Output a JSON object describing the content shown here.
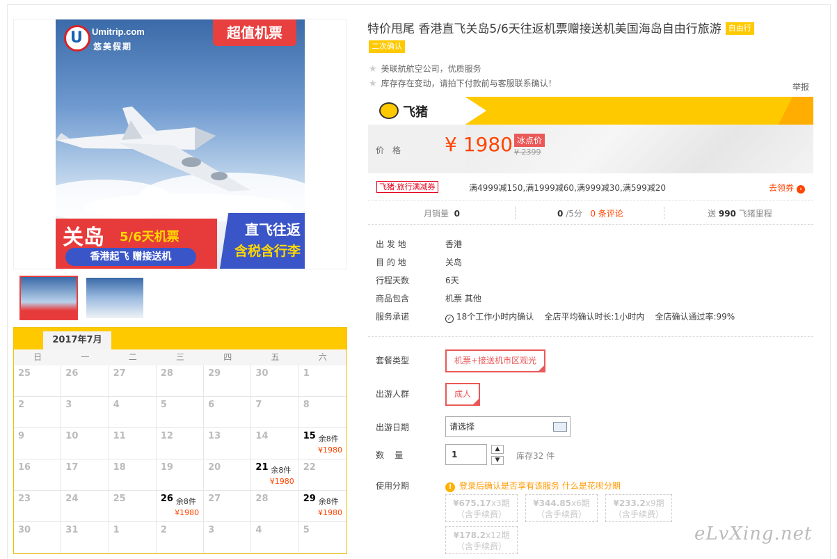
{
  "product": {
    "title": "特价甩尾 香港直飞关岛5/6天往返机票赠接送机美国海岛自由行旅游",
    "tag_free": "自由行",
    "tag_confirm": "二次确认",
    "notes": [
      "美联航航空公司，优质服务",
      "库存存在变动，请拍下付款前与客服联系确认！"
    ],
    "report": "举报"
  },
  "banner": {
    "logo_en": "Umitrip.com",
    "logo_cn": "悠美假期",
    "promo": "超值机票",
    "dest": "关岛",
    "days": "5/6天机票",
    "pill": "香港起飞 赠接送机",
    "right_l1": "直飞往返",
    "right_l2": "含税含行李"
  },
  "price": {
    "brand": "飞猪",
    "label": "价格",
    "value": "¥ 1980",
    "badge": "冰点价",
    "original": "¥ 2399"
  },
  "coupon": {
    "tag": "飞猪·旅行满减券",
    "text": "满4999减150,满1999减60,满999减30,满599减20",
    "link": "去领券"
  },
  "stats": {
    "sales_label": "月销量",
    "sales_value": "0",
    "rating_value": "0",
    "rating_suffix": "/5分",
    "reviews": "0 条评论",
    "miles_prefix": "送",
    "miles_value": "990",
    "miles_suffix": "飞猪里程"
  },
  "info": [
    {
      "k": "出 发 地",
      "v": "香港"
    },
    {
      "k": "目 的 地",
      "v": "关岛"
    },
    {
      "k": "行程天数",
      "v": "6天"
    },
    {
      "k": "商品包含",
      "v": "机票  其他"
    },
    {
      "k": "服务承诺",
      "v": "18个工作小时内确认    全店平均确认时长:1小时内    全店确认通过率:99%"
    }
  ],
  "options": {
    "package_label": "套餐类型",
    "package_value": "机票+接送机市区观光",
    "crowd_label": "出游人群",
    "crowd_value": "成人",
    "date_label": "出游日期",
    "date_placeholder": "请选择",
    "qty_label": "数    量",
    "qty_value": "1",
    "stock": "库存32 件",
    "install_label": "使用分期",
    "install_note": "登录后确认是否享有该服务",
    "install_link": "什么是花呗分期",
    "installments": [
      {
        "amount": "¥675.17",
        "period": "x3期",
        "fee": "（含手续费）"
      },
      {
        "amount": "¥344.85",
        "period": "x6期",
        "fee": "（含手续费）"
      },
      {
        "amount": "¥233.2",
        "period": "x9期",
        "fee": "（含手续费）"
      },
      {
        "amount": "¥178.2",
        "period": "x12期",
        "fee": "（含手续费）"
      }
    ]
  },
  "calendar": {
    "month": "2017年7月",
    "weekdays": [
      "日",
      "一",
      "二",
      "三",
      "四",
      "五",
      "六"
    ],
    "cells": [
      {
        "d": "25"
      },
      {
        "d": "26"
      },
      {
        "d": "27"
      },
      {
        "d": "28"
      },
      {
        "d": "29"
      },
      {
        "d": "30"
      },
      {
        "d": "1"
      },
      {
        "d": "2"
      },
      {
        "d": "3"
      },
      {
        "d": "4"
      },
      {
        "d": "5"
      },
      {
        "d": "6"
      },
      {
        "d": "7"
      },
      {
        "d": "8"
      },
      {
        "d": "9"
      },
      {
        "d": "10"
      },
      {
        "d": "11"
      },
      {
        "d": "12"
      },
      {
        "d": "13"
      },
      {
        "d": "14"
      },
      {
        "d": "15",
        "rem": "余8件",
        "pr": "¥1980"
      },
      {
        "d": "16"
      },
      {
        "d": "17"
      },
      {
        "d": "18"
      },
      {
        "d": "19"
      },
      {
        "d": "20"
      },
      {
        "d": "21",
        "rem": "余8件",
        "pr": "¥1980"
      },
      {
        "d": "22"
      },
      {
        "d": "23"
      },
      {
        "d": "24"
      },
      {
        "d": "25"
      },
      {
        "d": "26",
        "rem": "余8件",
        "pr": "¥1980"
      },
      {
        "d": "27"
      },
      {
        "d": "28"
      },
      {
        "d": "29",
        "rem": "余8件",
        "pr": "¥1980"
      },
      {
        "d": "30"
      },
      {
        "d": "31"
      },
      {
        "d": "1"
      },
      {
        "d": "2"
      },
      {
        "d": "3"
      },
      {
        "d": "4"
      },
      {
        "d": "5"
      }
    ]
  },
  "watermark": "eLvXing.net"
}
